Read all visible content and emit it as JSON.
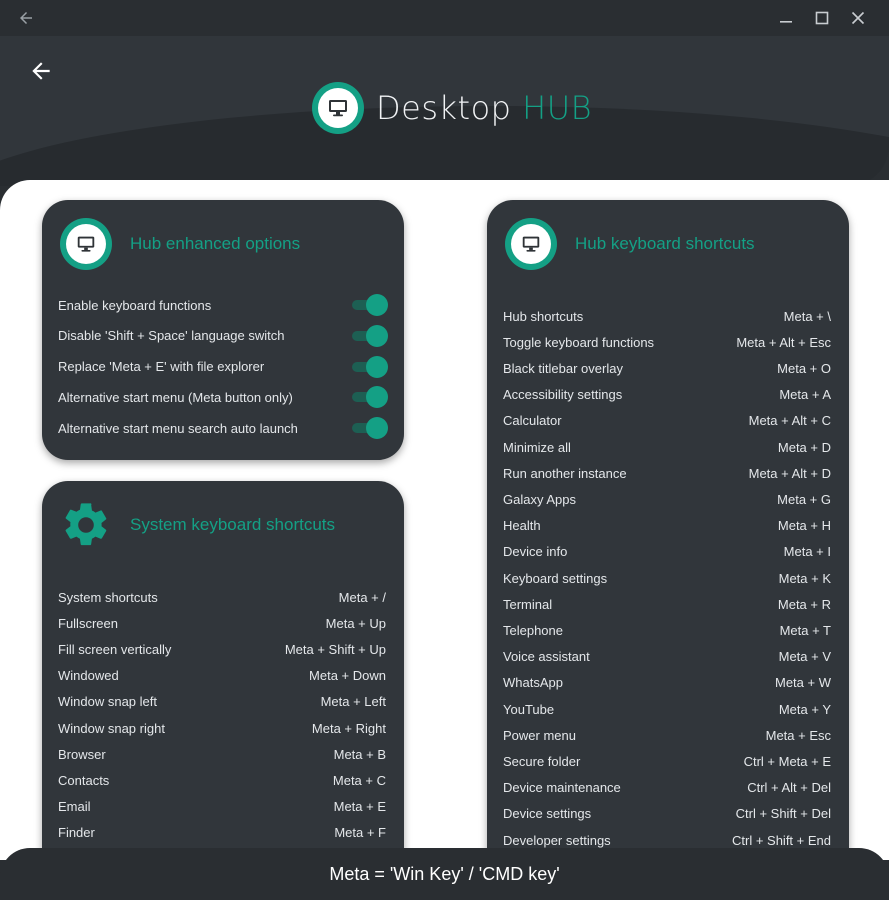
{
  "window": {
    "icons": {
      "back": "arrow-left-icon",
      "minimize": "minimize-icon",
      "maximize": "maximize-icon",
      "close": "close-icon"
    }
  },
  "header": {
    "title_part1": "Desktop",
    "title_part2": "HUB",
    "accent_color": "#14a085"
  },
  "enhanced": {
    "title": "Hub enhanced options",
    "options": [
      {
        "label": "Enable keyboard functions",
        "enabled": true
      },
      {
        "label": "Disable 'Shift + Space' language switch",
        "enabled": true
      },
      {
        "label": "Replace 'Meta + E' with file explorer",
        "enabled": true
      },
      {
        "label": "Alternative start menu (Meta button only)",
        "enabled": true
      },
      {
        "label": "Alternative start menu search auto launch",
        "enabled": true
      }
    ]
  },
  "system": {
    "title": "System keyboard shortcuts",
    "shortcuts": [
      {
        "label": "System shortcuts",
        "keys": "Meta + /"
      },
      {
        "label": "Fullscreen",
        "keys": "Meta + Up"
      },
      {
        "label": "Fill screen vertically",
        "keys": "Meta + Shift + Up"
      },
      {
        "label": "Windowed",
        "keys": "Meta + Down"
      },
      {
        "label": "Window snap left",
        "keys": "Meta + Left"
      },
      {
        "label": "Window snap right",
        "keys": "Meta + Right"
      },
      {
        "label": "Browser",
        "keys": "Meta + B"
      },
      {
        "label": "Contacts",
        "keys": "Meta + C"
      },
      {
        "label": "Email",
        "keys": "Meta + E"
      },
      {
        "label": "Finder",
        "keys": "Meta + F"
      }
    ]
  },
  "hub": {
    "title": "Hub keyboard shortcuts",
    "shortcuts": [
      {
        "label": "Hub shortcuts",
        "keys": "Meta + \\"
      },
      {
        "label": "Toggle keyboard functions",
        "keys": "Meta + Alt + Esc"
      },
      {
        "label": "Black titlebar overlay",
        "keys": "Meta + O"
      },
      {
        "label": "Accessibility settings",
        "keys": "Meta + A"
      },
      {
        "label": "Calculator",
        "keys": "Meta + Alt + C"
      },
      {
        "label": "Minimize all",
        "keys": "Meta + D"
      },
      {
        "label": "Run another instance",
        "keys": "Meta + Alt + D"
      },
      {
        "label": "Galaxy Apps",
        "keys": "Meta + G"
      },
      {
        "label": "Health",
        "keys": "Meta + H"
      },
      {
        "label": "Device info",
        "keys": "Meta + I"
      },
      {
        "label": "Keyboard settings",
        "keys": "Meta + K"
      },
      {
        "label": "Terminal",
        "keys": "Meta + R"
      },
      {
        "label": "Telephone",
        "keys": "Meta + T"
      },
      {
        "label": "Voice assistant",
        "keys": "Meta + V"
      },
      {
        "label": "WhatsApp",
        "keys": "Meta + W"
      },
      {
        "label": "YouTube",
        "keys": "Meta + Y"
      },
      {
        "label": "Power menu",
        "keys": "Meta + Esc"
      },
      {
        "label": "Secure folder",
        "keys": "Ctrl + Meta + E"
      },
      {
        "label": "Device maintenance",
        "keys": "Ctrl + Alt + Del"
      },
      {
        "label": "Device settings",
        "keys": "Ctrl + Shift + Del"
      },
      {
        "label": "Developer settings",
        "keys": "Ctrl + Shift + End"
      }
    ]
  },
  "footer": {
    "text": "Meta = 'Win Key' / 'CMD key'"
  }
}
